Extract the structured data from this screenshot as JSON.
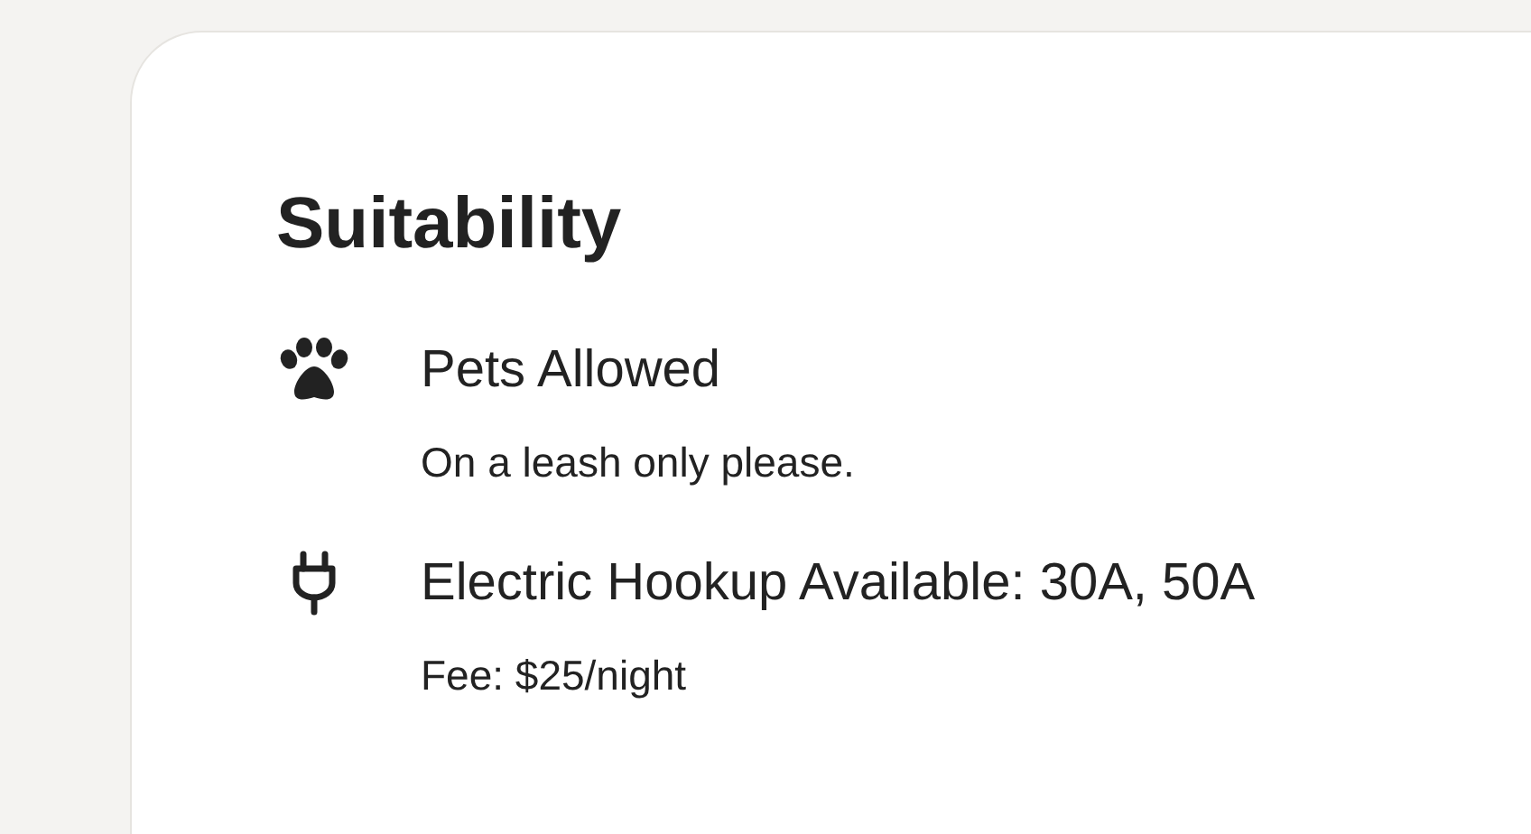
{
  "title": "Suitability",
  "items": [
    {
      "label": "Pets Allowed",
      "description": "On a leash only please."
    },
    {
      "label": "Electric Hookup Available: 30A, 50A",
      "description": "Fee: $25/night"
    }
  ]
}
